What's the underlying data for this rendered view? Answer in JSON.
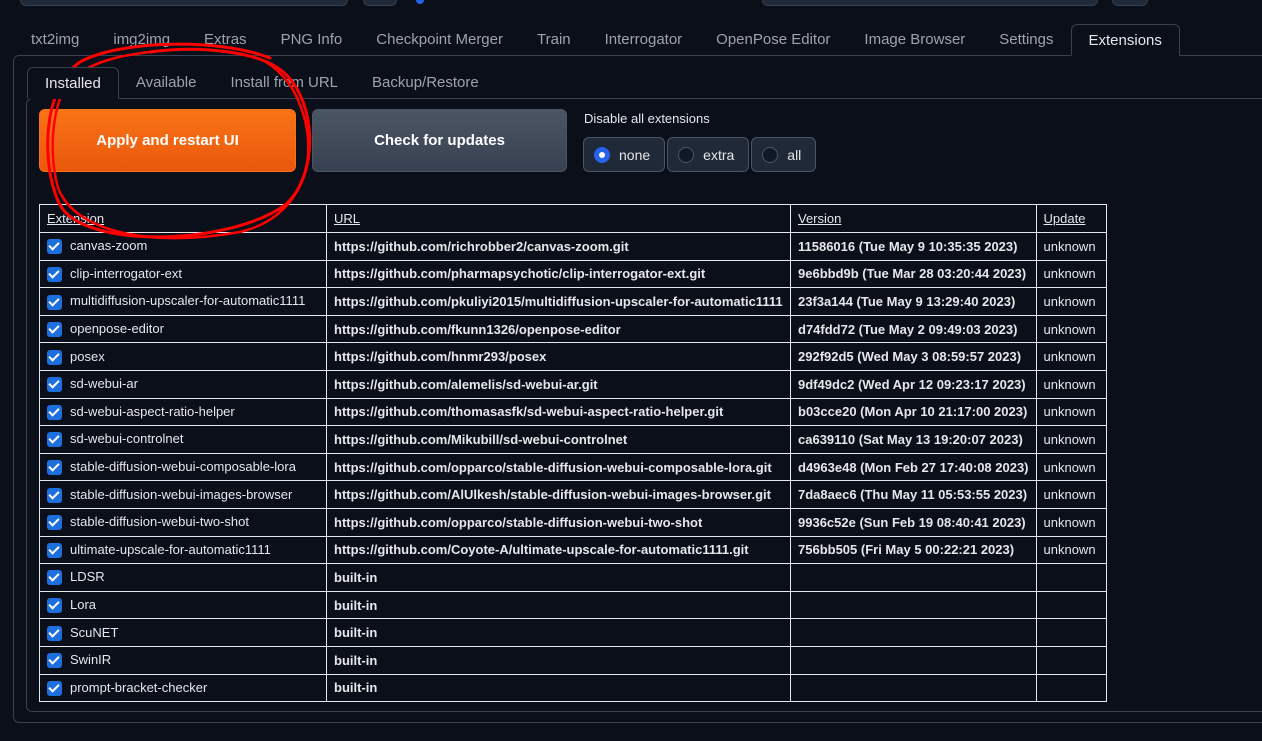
{
  "main_tabs": [
    "txt2img",
    "img2img",
    "Extras",
    "PNG Info",
    "Checkpoint Merger",
    "Train",
    "Interrogator",
    "OpenPose Editor",
    "Image Browser",
    "Settings",
    "Extensions"
  ],
  "main_tab_active": "Extensions",
  "sub_tabs": [
    "Installed",
    "Available",
    "Install from URL",
    "Backup/Restore"
  ],
  "sub_tab_active": "Installed",
  "buttons": {
    "apply": "Apply and restart UI",
    "check": "Check for updates"
  },
  "disable": {
    "label": "Disable all extensions",
    "options": [
      "none",
      "extra",
      "all"
    ],
    "selected": "none"
  },
  "table": {
    "headers": [
      "Extension",
      "URL",
      "Version",
      "Update"
    ],
    "rows": [
      {
        "name": "canvas-zoom",
        "url": "https://github.com/richrobber2/canvas-zoom.git",
        "version": "11586016 (Tue May 9 10:35:35 2023)",
        "update": "unknown"
      },
      {
        "name": "clip-interrogator-ext",
        "url": "https://github.com/pharmapsychotic/clip-interrogator-ext.git",
        "version": "9e6bbd9b (Tue Mar 28 03:20:44 2023)",
        "update": "unknown"
      },
      {
        "name": "multidiffusion-upscaler-for-automatic1111",
        "url": "https://github.com/pkuliyi2015/multidiffusion-upscaler-for-automatic1111",
        "version": "23f3a144 (Tue May 9 13:29:40 2023)",
        "update": "unknown"
      },
      {
        "name": "openpose-editor",
        "url": "https://github.com/fkunn1326/openpose-editor",
        "version": "d74fdd72 (Tue May 2 09:49:03 2023)",
        "update": "unknown"
      },
      {
        "name": "posex",
        "url": "https://github.com/hnmr293/posex",
        "version": "292f92d5 (Wed May 3 08:59:57 2023)",
        "update": "unknown"
      },
      {
        "name": "sd-webui-ar",
        "url": "https://github.com/alemelis/sd-webui-ar.git",
        "version": "9df49dc2 (Wed Apr 12 09:23:17 2023)",
        "update": "unknown"
      },
      {
        "name": "sd-webui-aspect-ratio-helper",
        "url": "https://github.com/thomasasfk/sd-webui-aspect-ratio-helper.git",
        "version": "b03cce20 (Mon Apr 10 21:17:00 2023)",
        "update": "unknown"
      },
      {
        "name": "sd-webui-controlnet",
        "url": "https://github.com/Mikubill/sd-webui-controlnet",
        "version": "ca639110 (Sat May 13 19:20:07 2023)",
        "update": "unknown"
      },
      {
        "name": "stable-diffusion-webui-composable-lora",
        "url": "https://github.com/opparco/stable-diffusion-webui-composable-lora.git",
        "version": "d4963e48 (Mon Feb 27 17:40:08 2023)",
        "update": "unknown"
      },
      {
        "name": "stable-diffusion-webui-images-browser",
        "url": "https://github.com/AlUlkesh/stable-diffusion-webui-images-browser.git",
        "version": "7da8aec6 (Thu May 11 05:53:55 2023)",
        "update": "unknown"
      },
      {
        "name": "stable-diffusion-webui-two-shot",
        "url": "https://github.com/opparco/stable-diffusion-webui-two-shot",
        "version": "9936c52e (Sun Feb 19 08:40:41 2023)",
        "update": "unknown"
      },
      {
        "name": "ultimate-upscale-for-automatic1111",
        "url": "https://github.com/Coyote-A/ultimate-upscale-for-automatic1111.git",
        "version": "756bb505 (Fri May 5 00:22:21 2023)",
        "update": "unknown"
      },
      {
        "name": "LDSR",
        "url": "built-in",
        "version": "",
        "update": ""
      },
      {
        "name": "Lora",
        "url": "built-in",
        "version": "",
        "update": ""
      },
      {
        "name": "ScuNET",
        "url": "built-in",
        "version": "",
        "update": ""
      },
      {
        "name": "SwinIR",
        "url": "built-in",
        "version": "",
        "update": ""
      },
      {
        "name": "prompt-bracket-checker",
        "url": "built-in",
        "version": "",
        "update": ""
      }
    ]
  },
  "colors": {
    "background": "#0b0f19",
    "accent_orange": "#f97316",
    "checkbox_blue": "#1d6fe0",
    "annotation_red": "#ff0000"
  }
}
